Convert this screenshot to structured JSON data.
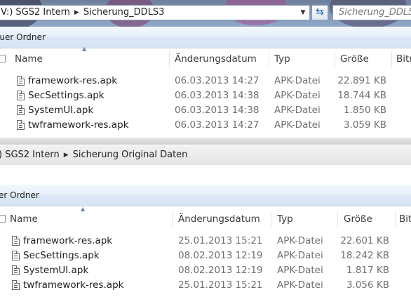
{
  "top": {
    "breadcrumb": [
      "V:) SGS2 Intern",
      "Sicherung_DDLS3"
    ],
    "search_placeholder": "Sicherung_DDLS3",
    "toolbar": {
      "new_folder": "euer Ordner"
    },
    "columns": {
      "name": "Name",
      "date": "Änderungsdatum",
      "type": "Typ",
      "size": "Größe",
      "extra": "Bitr"
    },
    "files": [
      {
        "name": "framework-res.apk",
        "date": "06.03.2013 14:27",
        "type": "APK-Datei",
        "size": "22.891 KB"
      },
      {
        "name": "SecSettings.apk",
        "date": "06.03.2013 14:38",
        "type": "APK-Datei",
        "size": "18.744 KB"
      },
      {
        "name": "SystemUI.apk",
        "date": "06.03.2013 14:38",
        "type": "APK-Datei",
        "size": "1.850 KB"
      },
      {
        "name": "twframework-res.apk",
        "date": "06.03.2013 14:27",
        "type": "APK-Datei",
        "size": "3.059 KB"
      }
    ]
  },
  "bottom": {
    "breadcrumb": [
      ") SGS2 Intern",
      "Sicherung Original Daten"
    ],
    "toolbar": {
      "new_folder": "er Ordner"
    },
    "columns": {
      "name": "Name",
      "date": "Änderungsdatum",
      "type": "Typ",
      "size": "Größe",
      "extra": "Bitr"
    },
    "files": [
      {
        "name": "framework-res.apk",
        "date": "25.01.2013 15:21",
        "type": "APK-Datei",
        "size": "22.601 KB"
      },
      {
        "name": "SecSettings.apk",
        "date": "08.02.2013 12:19",
        "type": "APK-Datei",
        "size": "18.242 KB"
      },
      {
        "name": "SystemUI.apk",
        "date": "08.02.2013 12:19",
        "type": "APK-Datei",
        "size": "1.817 KB"
      },
      {
        "name": "twframework-res.apk",
        "date": "25.01.2013 15:21",
        "type": "APK-Datei",
        "size": "3.056 KB"
      }
    ]
  },
  "icons": {
    "address_dropdown": "chevron-down-icon",
    "refresh": "refresh-icon",
    "file": "file-icon",
    "breadcrumb_separator": "chevron-right-icon"
  }
}
